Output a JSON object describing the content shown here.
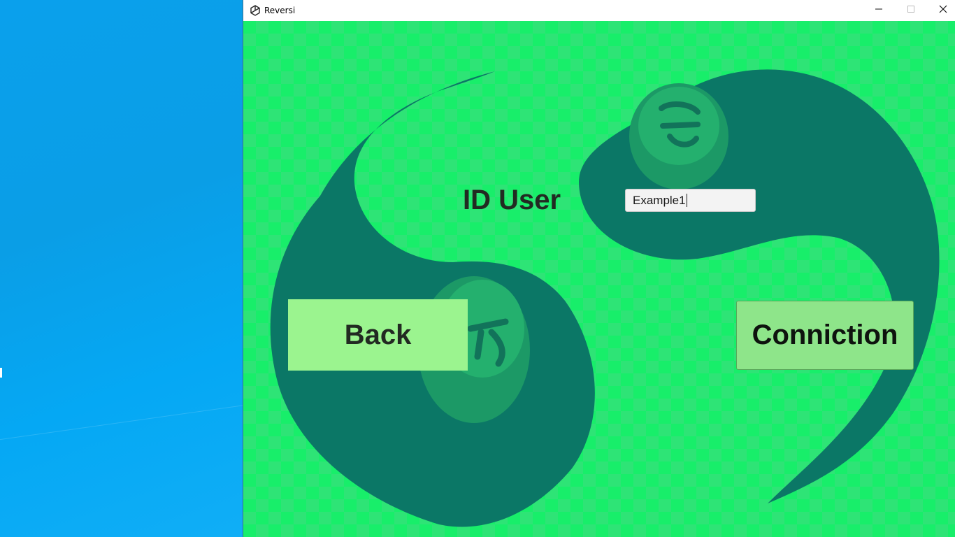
{
  "window": {
    "title": "Reversi",
    "icon": "unity-icon",
    "controls": [
      "minimize-icon",
      "maximize-icon",
      "close-icon"
    ]
  },
  "form": {
    "id_label": "ID User",
    "id_input_value": "Example1",
    "back_label": "Back",
    "connect_label": "Conniction"
  },
  "colors": {
    "background_green": "#18ee6a",
    "swirl": "#0b7766",
    "back_button": "#9bf48f",
    "connect_button": "#8ee58a"
  }
}
